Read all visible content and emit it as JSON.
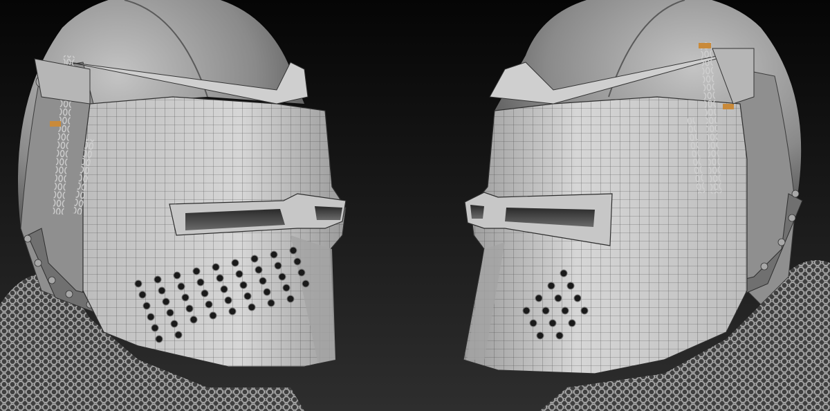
{
  "scene": {
    "subject": "",
    "colors": {
      "background_top": "#050505",
      "background_bottom": "#2e2e2e",
      "metal_light": "#d8d8d8",
      "metal_mid": "#a9a9a9",
      "metal_dark": "#5c5c5c",
      "wire": "#3a3a3a",
      "brass": "#c98a3a"
    },
    "left_helmet": {
      "facing": "right",
      "breath_holes": 46
    },
    "right_helmet": {
      "facing": "left",
      "breath_holes": 15
    }
  }
}
